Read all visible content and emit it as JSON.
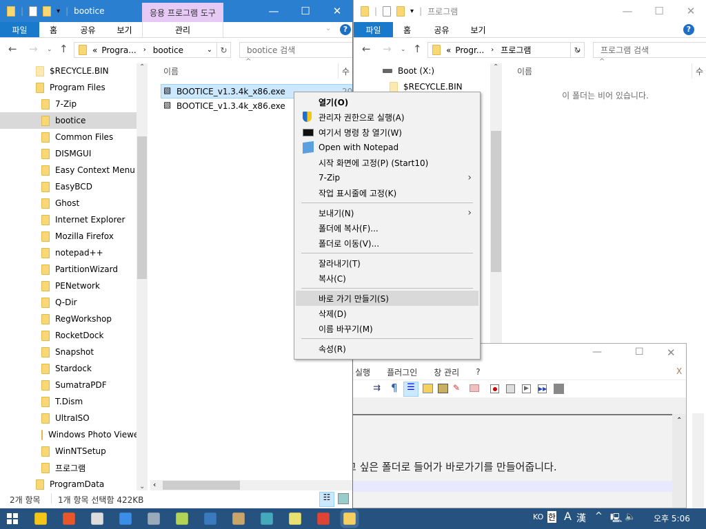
{
  "left_window": {
    "title": "bootice",
    "context_tab": "응용 프로그램 도구",
    "context_sub": "관리",
    "tabs": [
      "파일",
      "홈",
      "공유",
      "보기"
    ],
    "address": {
      "prefix": "«",
      "parent": "Progra...",
      "current": "bootice"
    },
    "search_placeholder": "bootice 검색",
    "tree": [
      "$RECYCLE.BIN",
      "Program Files",
      "7-Zip",
      "bootice",
      "Common Files",
      "DISMGUI",
      "Easy Context Menu",
      "EasyBCD",
      "Ghost",
      "Internet Explorer",
      "Mozilla Firefox",
      "notepad++",
      "PartitionWizard",
      "PENetwork",
      "Q-Dir",
      "RegWorkshop",
      "RocketDock",
      "Snapshot",
      "Stardock",
      "SumatraPDF",
      "T.Dism",
      "UltraISO",
      "Windows Photo Viewer",
      "WinNTSetup",
      "프로그램",
      "ProgramData"
    ],
    "selected_tree": "bootice",
    "col_name": "이름",
    "col_date": "수",
    "files": [
      {
        "name": "BOOTICE_v1.3.4k_x86.exe",
        "date": "20",
        "selected": true
      },
      {
        "name": "BOOTICE_v1.3.4k_x86.exe",
        "date": "",
        "selected": false
      }
    ],
    "status": {
      "count": "2개 항목",
      "selection": "1개 항목 선택함 422KB"
    }
  },
  "right_window": {
    "title": "프로그램",
    "tabs": [
      "파일",
      "홈",
      "공유",
      "보기"
    ],
    "address": {
      "prefix": "«",
      "parent": "Progr...",
      "current": "프로그램"
    },
    "search_placeholder": "프로그램 검색",
    "tree": [
      "Boot (X:)",
      "$RECYCLE.BIN"
    ],
    "col_name": "이름",
    "col_date": "수",
    "empty_message": "이 폴더는 비어 있습니다."
  },
  "context_menu": {
    "items": [
      {
        "label": "열기(O)",
        "bold": true,
        "icon": ""
      },
      {
        "label": "관리자 권한으로 실행(A)",
        "icon": "uac-shield-icon"
      },
      {
        "label": "여기서 명령 창 열기(W)",
        "icon": "cmd-icon"
      },
      {
        "label": "Open with Notepad",
        "icon": "notepad-icon"
      },
      {
        "label": "시작 화면에 고정(P) (Start10)",
        "icon": ""
      },
      {
        "label": "7-Zip",
        "submenu": true
      },
      {
        "label": "작업 표시줄에 고정(K)"
      },
      {
        "sep": true
      },
      {
        "label": "보내기(N)",
        "submenu": true
      },
      {
        "label": "폴더에 복사(F)..."
      },
      {
        "label": "폴더로 이동(V)..."
      },
      {
        "sep": true
      },
      {
        "label": "잘라내기(T)"
      },
      {
        "label": "복사(C)"
      },
      {
        "sep": true
      },
      {
        "label": "바로 가기 만들기(S)",
        "hover": true
      },
      {
        "label": "삭제(D)"
      },
      {
        "label": "이름 바꾸기(M)"
      },
      {
        "sep": true
      },
      {
        "label": "속성(R)"
      }
    ]
  },
  "notepad": {
    "menu": [
      "실행",
      "플러그인",
      "창 관리",
      "?"
    ],
    "close_doc": "X",
    "text_line": "고 싶은 폴더로 들어가 바로가기를 만들어줍니다."
  },
  "taskbar": {
    "lang": "KO",
    "ime_hangul": "한",
    "ime_a": "A",
    "ime_hanja": "漢",
    "clock": "오후 5:06",
    "apps": [
      "start-icon",
      "file-explorer-icon",
      "firefox-icon",
      "app-icon",
      "app-icon",
      "app-icon",
      "app-icon",
      "app-icon",
      "app-icon",
      "app-icon",
      "notepad-icon",
      "chrome-icon",
      "app-icon",
      "folder-icon"
    ]
  },
  "colors": {
    "titlebar_active": "#2b7fd0",
    "file_tab": "#1979ca",
    "context_tab": "#e6c9f5",
    "taskbar": "#25527f",
    "selection": "#cce8ff"
  }
}
